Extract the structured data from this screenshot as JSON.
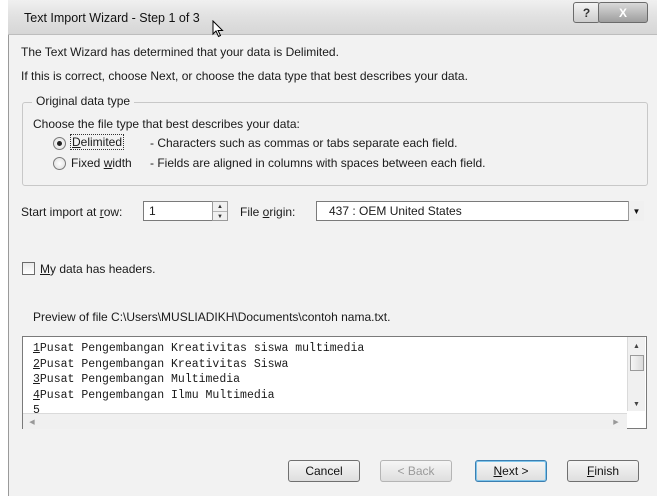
{
  "window": {
    "title": "Text Import Wizard - Step 1 of 3",
    "help_label": "?",
    "close_label": "X"
  },
  "intro": {
    "line1": "The Text Wizard has determined that your data is Delimited.",
    "line2": "If this is correct, choose Next, or choose the data type that best describes your data."
  },
  "data_type": {
    "legend": "Original data type",
    "prompt": "Choose the file type that best describes your data:",
    "options": [
      {
        "label_pre": "",
        "label_key": "D",
        "label_post": "elimited",
        "description": "- Characters such as commas or tabs separate each field.",
        "selected": true
      },
      {
        "label_pre": "Fixed ",
        "label_key": "w",
        "label_post": "idth",
        "description": "- Fields are aligned in columns with spaces between each field.",
        "selected": false
      }
    ]
  },
  "start_row": {
    "label_pre": "Start import at ",
    "label_key": "r",
    "label_post": "ow:",
    "value": "1"
  },
  "file_origin": {
    "label_pre": "File ",
    "label_key": "o",
    "label_post": "rigin:",
    "value": "437 : OEM United States"
  },
  "headers": {
    "label_key": "M",
    "label_post": "y data has headers.",
    "checked": false
  },
  "preview": {
    "caption": "Preview of file C:\\Users\\MUSLIADIKH\\Documents\\contoh nama.txt.",
    "lines": [
      {
        "num": "1",
        "text": "Pusat Pengembangan Kreativitas siswa multimedia"
      },
      {
        "num": "2",
        "text": "Pusat Pengembangan Kreativitas Siswa"
      },
      {
        "num": "3",
        "text": "Pusat Pengembangan Multimedia"
      },
      {
        "num": "4",
        "text": "Pusat Pengembangan Ilmu Multimedia"
      },
      {
        "num": "5",
        "text": ""
      }
    ]
  },
  "buttons": {
    "cancel": "Cancel",
    "back": "< Back",
    "next_key": "N",
    "next_post": "ext >",
    "finish_key": "F",
    "finish_post": "inish"
  }
}
